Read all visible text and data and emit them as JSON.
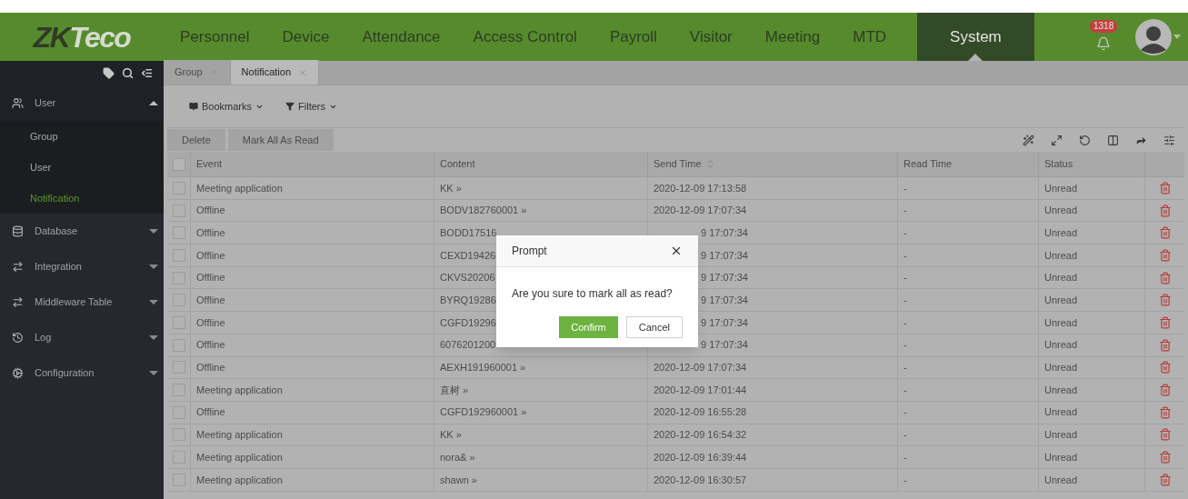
{
  "header": {
    "logo": [
      "ZK",
      "Teco"
    ],
    "nav": [
      {
        "label": "Personnel",
        "selected": false
      },
      {
        "label": "Device",
        "selected": false
      },
      {
        "label": "Attendance",
        "selected": false
      },
      {
        "label": "Access Control",
        "selected": false
      },
      {
        "label": "Payroll",
        "selected": false
      },
      {
        "label": "Visitor",
        "selected": false
      },
      {
        "label": "Meeting",
        "selected": false
      },
      {
        "label": "MTD",
        "selected": false
      },
      {
        "label": "System",
        "selected": true
      }
    ],
    "notification_count": "1318"
  },
  "sidebar": {
    "groups": [
      {
        "label": "User",
        "expanded": true,
        "children": [
          {
            "label": "Group",
            "selected": false
          },
          {
            "label": "User",
            "selected": false
          },
          {
            "label": "Notification",
            "selected": true
          }
        ]
      },
      {
        "label": "Database",
        "expanded": false
      },
      {
        "label": "Integration",
        "expanded": false
      },
      {
        "label": "Middleware Table",
        "expanded": false
      },
      {
        "label": "Log",
        "expanded": false
      },
      {
        "label": "Configuration",
        "expanded": false
      }
    ]
  },
  "tabs": [
    {
      "label": "Group",
      "selected": false
    },
    {
      "label": "Notification",
      "selected": true
    }
  ],
  "toolbar": {
    "menus": [
      "Bookmarks",
      "Filters"
    ],
    "actions": [
      "Delete",
      "Mark All As Read"
    ]
  },
  "table": {
    "all_checked": false,
    "columns": [
      {
        "label": "Event",
        "sortable": false
      },
      {
        "label": "Content",
        "sortable": false
      },
      {
        "label": "Send Time",
        "sortable": true
      },
      {
        "label": "Read Time",
        "sortable": false
      },
      {
        "label": "Status",
        "sortable": false
      }
    ],
    "rows": [
      {
        "checked": false,
        "event": "Meeting application",
        "content": "KK »",
        "send_time": "2020-12-09 17:13:58",
        "read_time": "-",
        "status": "Unread",
        "partly_hidden": false
      },
      {
        "checked": false,
        "event": "Offline",
        "content": "BODV182760001 »",
        "send_time": "2020-12-09 17:07:34",
        "read_time": "-",
        "status": "Unread",
        "partly_hidden": false
      },
      {
        "checked": false,
        "event": "Offline",
        "content": "BODD17516",
        "send_time": "9 17:07:34",
        "read_time": "-",
        "status": "Unread",
        "partly_hidden": true
      },
      {
        "checked": false,
        "event": "Offline",
        "content": "CEXD19426",
        "send_time": "9 17:07:34",
        "read_time": "-",
        "status": "Unread",
        "partly_hidden": true
      },
      {
        "checked": false,
        "event": "Offline",
        "content": "CKVS20206",
        "send_time": "9 17:07:34",
        "read_time": "-",
        "status": "Unread",
        "partly_hidden": true
      },
      {
        "checked": false,
        "event": "Offline",
        "content": "BYRQ19286",
        "send_time": "9 17:07:34",
        "read_time": "-",
        "status": "Unread",
        "partly_hidden": true
      },
      {
        "checked": false,
        "event": "Offline",
        "content": "CGFD19296",
        "send_time": "9 17:07:34",
        "read_time": "-",
        "status": "Unread",
        "partly_hidden": true
      },
      {
        "checked": false,
        "event": "Offline",
        "content": "6076201200",
        "send_time": "9 17:07:34",
        "read_time": "-",
        "status": "Unread",
        "partly_hidden": true
      },
      {
        "checked": false,
        "event": "Offline",
        "content": "AEXH191960001 »",
        "send_time": "2020-12-09 17:07:34",
        "read_time": "-",
        "status": "Unread",
        "partly_hidden": false
      },
      {
        "checked": false,
        "event": "Meeting application",
        "content": "直树 »",
        "send_time": "2020-12-09 17:01:44",
        "read_time": "-",
        "status": "Unread",
        "partly_hidden": false
      },
      {
        "checked": false,
        "event": "Offline",
        "content": "CGFD192960001 »",
        "send_time": "2020-12-09 16:55:28",
        "read_time": "-",
        "status": "Unread",
        "partly_hidden": false
      },
      {
        "checked": false,
        "event": "Meeting application",
        "content": "KK »",
        "send_time": "2020-12-09 16:54:32",
        "read_time": "-",
        "status": "Unread",
        "partly_hidden": false
      },
      {
        "checked": false,
        "event": "Meeting application",
        "content": "nora& »",
        "send_time": "2020-12-09 16:39:44",
        "read_time": "-",
        "status": "Unread",
        "partly_hidden": false
      },
      {
        "checked": false,
        "event": "Meeting application",
        "content": "shawn »",
        "send_time": "2020-12-09 16:30:57",
        "read_time": "-",
        "status": "Unread",
        "partly_hidden": false
      }
    ]
  },
  "dialog": {
    "title": "Prompt",
    "message": "Are you sure to mark all as read?",
    "buttons": [
      {
        "label": "Confirm",
        "kind": "primary"
      },
      {
        "label": "Cancel",
        "kind": "default"
      }
    ]
  }
}
